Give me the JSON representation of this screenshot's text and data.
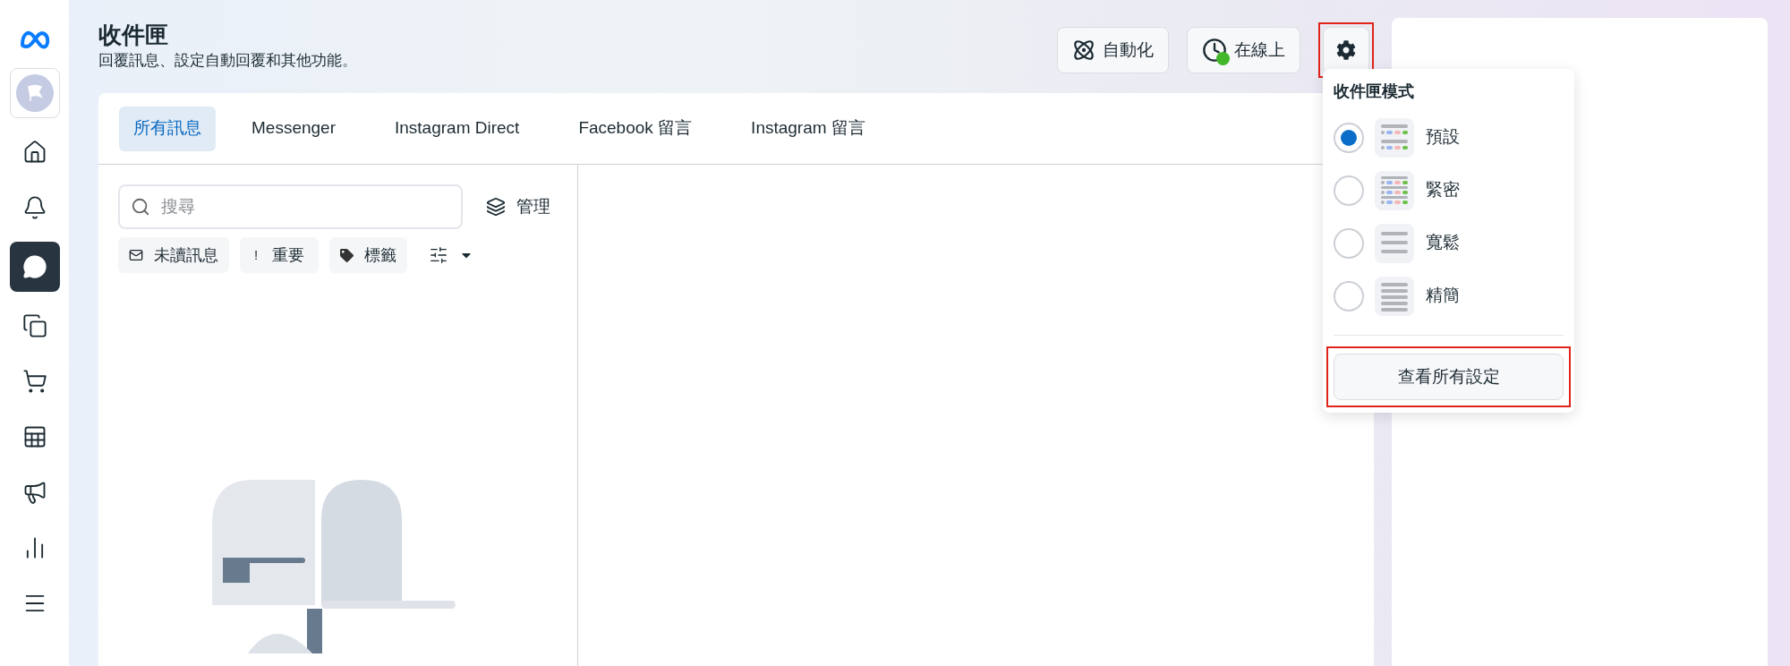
{
  "sidebar": {
    "items": [
      {
        "kind": "home",
        "selected": false
      },
      {
        "kind": "bell",
        "selected": false
      },
      {
        "kind": "chat",
        "selected": true
      },
      {
        "kind": "pages",
        "selected": false
      },
      {
        "kind": "cart",
        "selected": false
      },
      {
        "kind": "table",
        "selected": false
      },
      {
        "kind": "megaphone",
        "selected": false
      },
      {
        "kind": "chart",
        "selected": false
      },
      {
        "kind": "menu",
        "selected": false
      }
    ]
  },
  "header": {
    "title": "收件匣",
    "subtitle": "回覆訊息、設定自動回覆和其他功能。"
  },
  "toolbar": [
    {
      "kind": "automation",
      "label": "自動化",
      "highlighted": false
    },
    {
      "kind": "status",
      "label": "在線上",
      "online": true,
      "highlighted": false
    },
    {
      "kind": "settings",
      "highlighted": true
    }
  ],
  "tabs": [
    {
      "label": "所有訊息",
      "selected": true
    },
    {
      "label": "Messenger",
      "selected": false
    },
    {
      "label": "Instagram Direct",
      "selected": false
    },
    {
      "label": "Facebook 留言",
      "selected": false
    },
    {
      "label": "Instagram 留言",
      "selected": false
    }
  ],
  "search": {
    "placeholder": "搜尋"
  },
  "manage": {
    "label": "管理"
  },
  "filters": [
    {
      "kind": "envelope",
      "label": "未讀訊息"
    },
    {
      "kind": "mark",
      "symbol": "!",
      "label": "重要"
    },
    {
      "kind": "tag",
      "label": "標籤"
    },
    {
      "kind": "options"
    }
  ],
  "inbox_mode_menu": {
    "title": "收件匣模式",
    "options": [
      {
        "kind": "default",
        "label": "預設",
        "selected": true
      },
      {
        "kind": "compact",
        "label": "緊密",
        "selected": false
      },
      {
        "kind": "spacious",
        "label": "寬鬆",
        "selected": false
      },
      {
        "kind": "minimal",
        "label": "精簡",
        "selected": false
      }
    ],
    "button": {
      "label": "查看所有設定",
      "highlighted": true
    }
  }
}
